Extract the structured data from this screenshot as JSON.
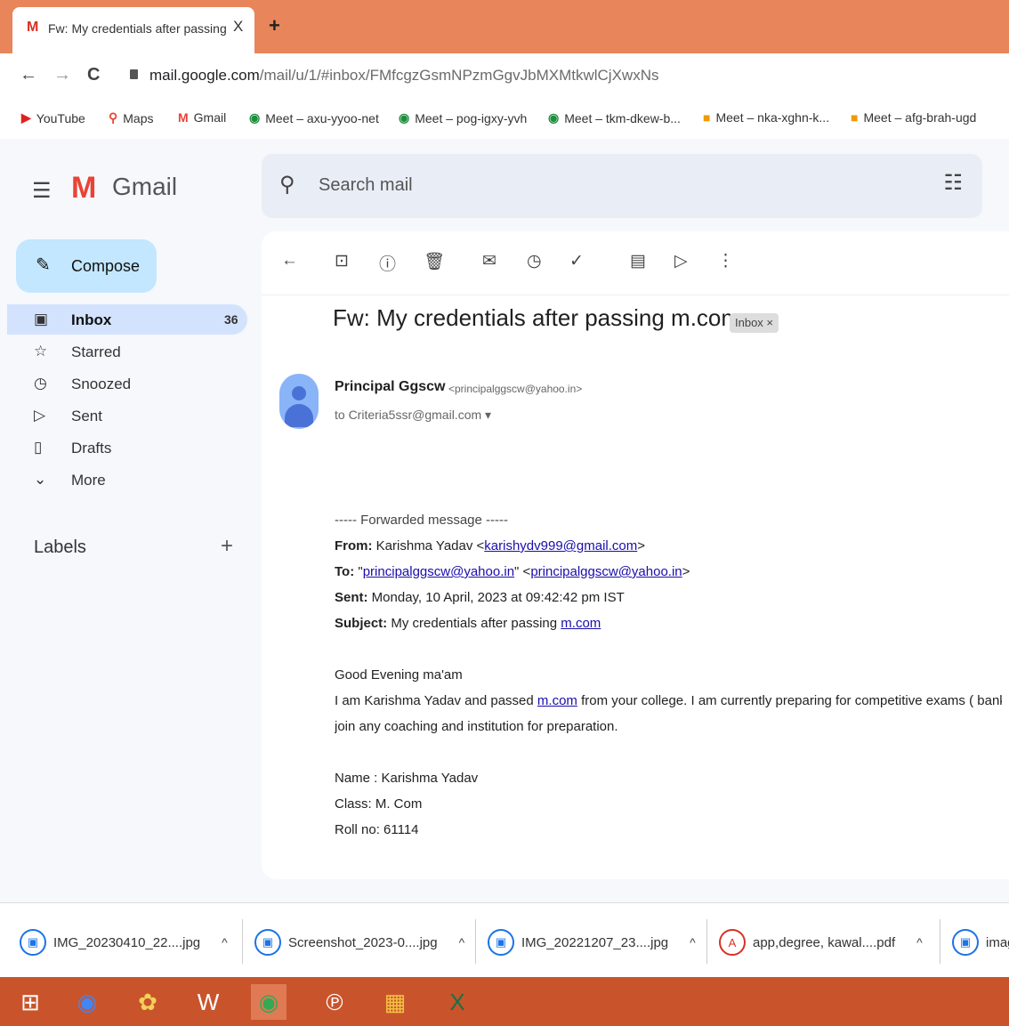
{
  "browser": {
    "tab_title": "Fw: My credentials after passing",
    "tab_favicon": "M",
    "tab_close": "X",
    "new_tab": "+",
    "url_host": "mail.google.com",
    "url_path": "/mail/u/1/#inbox/FMfcgzGsmNPzmGgvJbMXMtkwlCjXwxNs",
    "back_icon": "←",
    "forward_icon": "→",
    "reload_icon": "C"
  },
  "bookmarks": [
    {
      "label": "YouTube",
      "icon": "▶",
      "color": "#e02020"
    },
    {
      "label": "Maps",
      "icon": "⚲",
      "color": "#ea4335"
    },
    {
      "label": "Gmail",
      "icon": "M",
      "color": "#ea4335"
    },
    {
      "label": "Meet – axu-yyoo-net",
      "icon": "◉",
      "color": "#1e8e3e"
    },
    {
      "label": "Meet – pog-igxy-yvh",
      "icon": "◉",
      "color": "#1e8e3e"
    },
    {
      "label": "Meet – tkm-dkew-b...",
      "icon": "◉",
      "color": "#1e8e3e"
    },
    {
      "label": "Meet – nka-xghn-k...",
      "icon": "■",
      "color": "#f29900"
    },
    {
      "label": "Meet – afg-brah-ugd",
      "icon": "■",
      "color": "#f29900"
    }
  ],
  "gmail": {
    "logo_text": "Gmail",
    "search_placeholder": "Search mail",
    "compose_label": "Compose",
    "nav": [
      {
        "label": "Inbox",
        "icon": "▣",
        "count": "36"
      },
      {
        "label": "Starred",
        "icon": "☆",
        "count": ""
      },
      {
        "label": "Snoozed",
        "icon": "◷",
        "count": ""
      },
      {
        "label": "Sent",
        "icon": "▷",
        "count": ""
      },
      {
        "label": "Drafts",
        "icon": "▯",
        "count": ""
      },
      {
        "label": "More",
        "icon": "⌄",
        "count": ""
      }
    ],
    "labels_title": "Labels",
    "labels_add": "+"
  },
  "message": {
    "subject": "Fw: My credentials after passing m.com",
    "inbox_chip": "Inbox ×",
    "sender_name": "Principal Ggscw",
    "sender_email": "<principalggscw@yahoo.in>",
    "recipient": "to Criteria5ssr@gmail.com ▾",
    "fwd_header": "----- Forwarded message -----",
    "from_label": "From:",
    "from_name": "Karishma Yadav <",
    "from_email": "karishydv999@gmail.com",
    "from_end": ">",
    "to_label": "To:",
    "to_quote_open": "\"",
    "to_email1": "principalggscw@yahoo.in",
    "to_mid": "\" <",
    "to_email2": "principalggscw@yahoo.in",
    "to_end": ">",
    "sent_label": "Sent:",
    "sent_value": "Monday, 10 April, 2023 at 09:42:42 pm IST",
    "subject_label": "Subject:",
    "subject_value": "My credentials after passing",
    "subject_link": "m.com",
    "greeting": "Good Evening ma'am",
    "body1_a": "I am Karishma Yadav and passed",
    "body1_link": "m.com",
    "body1_b": "from your college. I am currently preparing for competitive exams ( bank cle",
    "body2": "join any coaching and institution for preparation.",
    "name_line": "Name : Karishma Yadav",
    "class_line": "Class: M. Com",
    "roll_line": "Roll no: 61114"
  },
  "downloads": [
    {
      "name": "IMG_20230410_22....jpg",
      "type": "image"
    },
    {
      "name": "Screenshot_2023-0....jpg",
      "type": "image"
    },
    {
      "name": "IMG_20221207_23....jpg",
      "type": "image"
    },
    {
      "name": "app,degree, kawal....pdf",
      "type": "pdf"
    },
    {
      "name": "imag",
      "type": "image"
    }
  ],
  "taskbar": {
    "start": "⊞",
    "apps": [
      "chrome-icon",
      "paint-icon",
      "word-icon",
      "chrome-active-icon",
      "pinterest-icon",
      "file-explorer-icon",
      "excel-icon"
    ]
  },
  "colors": {
    "tabstrip": "#e8855a",
    "taskbar": "#c9542b",
    "compose": "#c2e7ff",
    "inbox_active": "#d3e3fd"
  }
}
